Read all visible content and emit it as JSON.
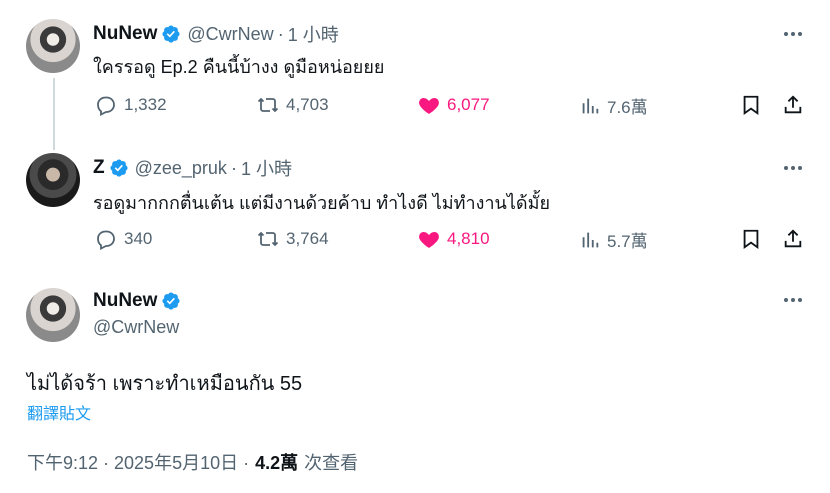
{
  "tweets": [
    {
      "display_name": "NuNew",
      "handle": "@CwrNew",
      "separator": "·",
      "time": "1 小時",
      "text": "ใครรอดู Ep.2 คืนนี้บ้างง ดูมือหน่อยยย",
      "replies": "1,332",
      "retweets": "4,703",
      "likes": "6,077",
      "views": "7.6萬"
    },
    {
      "display_name": "Z",
      "handle": "@zee_pruk",
      "separator": "·",
      "time": "1 小時",
      "text": "รอดูมากกกตื่นเต้น แต่มีงานด้วยค้าบ ทำไงดี ไม่ทำงานได้มั้ย",
      "replies": "340",
      "retweets": "3,764",
      "likes": "4,810",
      "views": "5.7萬"
    }
  ],
  "detail": {
    "display_name": "NuNew",
    "handle": "@CwrNew",
    "text": "ไม่ได้จร้า เพราะทำเหมือนกัน 55",
    "translate_label": "翻譯貼文",
    "timestamp": "下午9:12 · 2025年5月10日 ·",
    "views_count": "4.2萬",
    "views_label": "次查看"
  },
  "colors": {
    "verified": "#1d9bf0",
    "like_active": "#f91880",
    "muted": "#536471",
    "thread_line": "#cfd9de"
  },
  "icons": [
    "verified-badge-icon",
    "more-icon",
    "reply-icon",
    "retweet-icon",
    "like-icon",
    "views-icon",
    "bookmark-icon",
    "share-icon"
  ]
}
